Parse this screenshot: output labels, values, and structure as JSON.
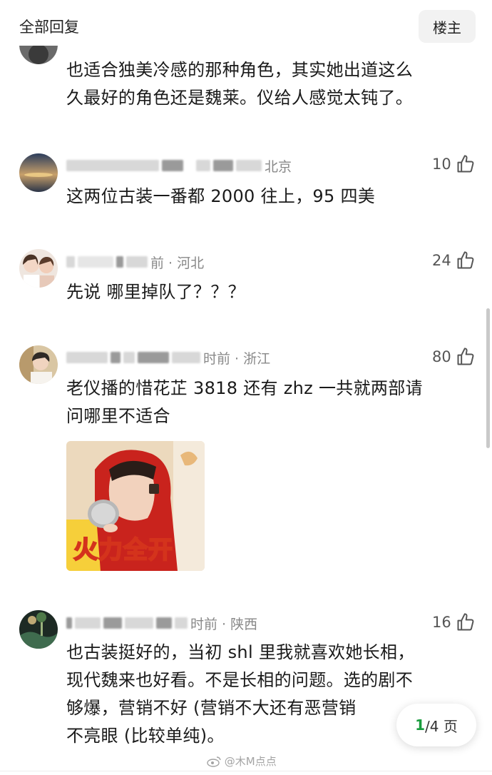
{
  "header": {
    "title": "全部回复",
    "op_button": "楼主"
  },
  "comments": [
    {
      "text_lines": [
        "也适合独美冷感的那种角色，其实她出道这么",
        "久最好的角色还是魏莱。仪给人感觉太钝了。"
      ]
    },
    {
      "meta_visible": "北京",
      "likes": "10",
      "text_lines": [
        "这两位古装一番都 2000 往上，95 四美"
      ]
    },
    {
      "meta_visible": "前 · 河北",
      "likes": "24",
      "text_lines": [
        "先说 哪里掉队了？？？"
      ]
    },
    {
      "meta_visible": "时前 · 浙江",
      "likes": "80",
      "text_lines": [
        "老仪播的惜花芷 3818 还有 zhz 一共就两部请",
        "问哪里不适合"
      ],
      "sticker_caption": "火力全开"
    },
    {
      "meta_visible": "时前 · 陕西",
      "likes": "16",
      "text_lines": [
        "也古装挺好的，当初 shl 里我就喜欢她长相，",
        "现代魏来也好看。不是长相的问题。选的剧不",
        "够爆，营销不好 (营销不大还有恶营销",
        "不亮眼 (比较单纯)。"
      ]
    }
  ],
  "pager": {
    "current": "1",
    "rest": "/4 页"
  },
  "watermark": "@木M点点",
  "icons": {
    "like": "thumbs-up-icon",
    "weibo": "weibo-logo-icon"
  },
  "colors": {
    "accent_green": "#1a9c3e",
    "text": "#1a1a1a",
    "meta": "#888888"
  }
}
